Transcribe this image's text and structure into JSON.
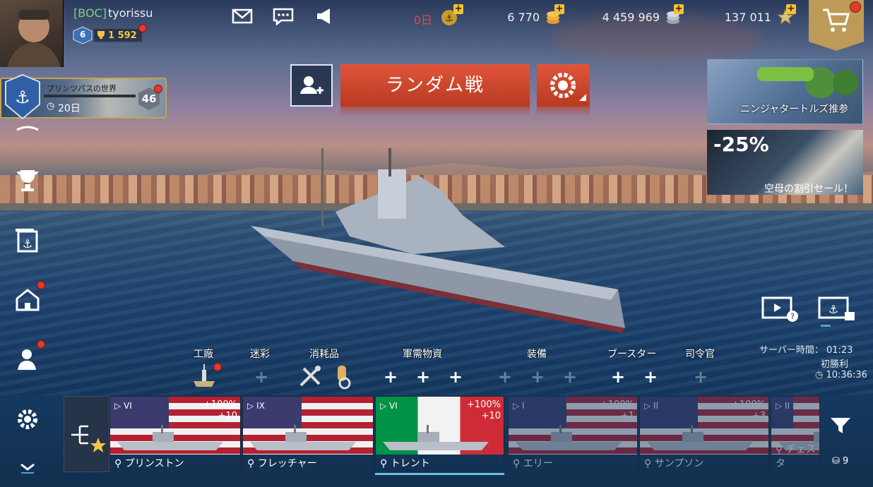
{
  "player": {
    "clan_tag": "[BOC]",
    "name": "tyorissu",
    "rank_level": "6",
    "rating": "1 592"
  },
  "resources": {
    "premium_days": "0日",
    "doubloons": "6 770",
    "credits": "4 459 969",
    "free_xp": "137 011"
  },
  "mission": {
    "title": "プリンツパスの世界",
    "days": "20日",
    "level": "46"
  },
  "main_menu": {
    "battle_button": "ランダム戦"
  },
  "promos": [
    {
      "text": "ニンジャタートルズ推参"
    },
    {
      "discount": "-25%",
      "text": "空母の割引セール！"
    }
  ],
  "info": {
    "server_time": "サーバー時間： 01:23",
    "first_win": "初勝利",
    "timer": "10:36:36"
  },
  "loadout": {
    "categories": [
      "工廠",
      "迷彩",
      "消耗品",
      "軍需物資",
      "装備",
      "ブースター",
      "司令官"
    ]
  },
  "carousel": [
    {
      "tier": "VI",
      "bonus_xp": "+100%",
      "bonus_points": "+10",
      "name": "プリンストン",
      "nation_color": "#b22234"
    },
    {
      "tier": "IX",
      "bonus_xp": "",
      "bonus_points": "",
      "name": "フレッチャー",
      "nation_color": "#b22234"
    },
    {
      "tier": "VI",
      "bonus_xp": "+100%",
      "bonus_points": "+10",
      "name": "トレント",
      "nation_color": "#009246"
    },
    {
      "tier": "I",
      "bonus_xp": "+100%",
      "bonus_points": "+1",
      "name": "エリー",
      "nation_color": "#b22234"
    },
    {
      "tier": "II",
      "bonus_xp": "+100%",
      "bonus_points": "+3",
      "name": "サンプソン",
      "nation_color": "#b22234"
    },
    {
      "tier": "II",
      "bonus_xp": "",
      "bonus_points": "",
      "name": "チェスタ",
      "nation_color": "#b22234"
    }
  ],
  "ship_count": "9",
  "icons": [
    "mail-icon",
    "chat-icon",
    "announcement-icon",
    "cart-icon",
    "add-friend-icon",
    "settings-gear-icon",
    "trophy-icon",
    "armory-icon",
    "port-icon",
    "crew-icon",
    "filter-icon"
  ]
}
